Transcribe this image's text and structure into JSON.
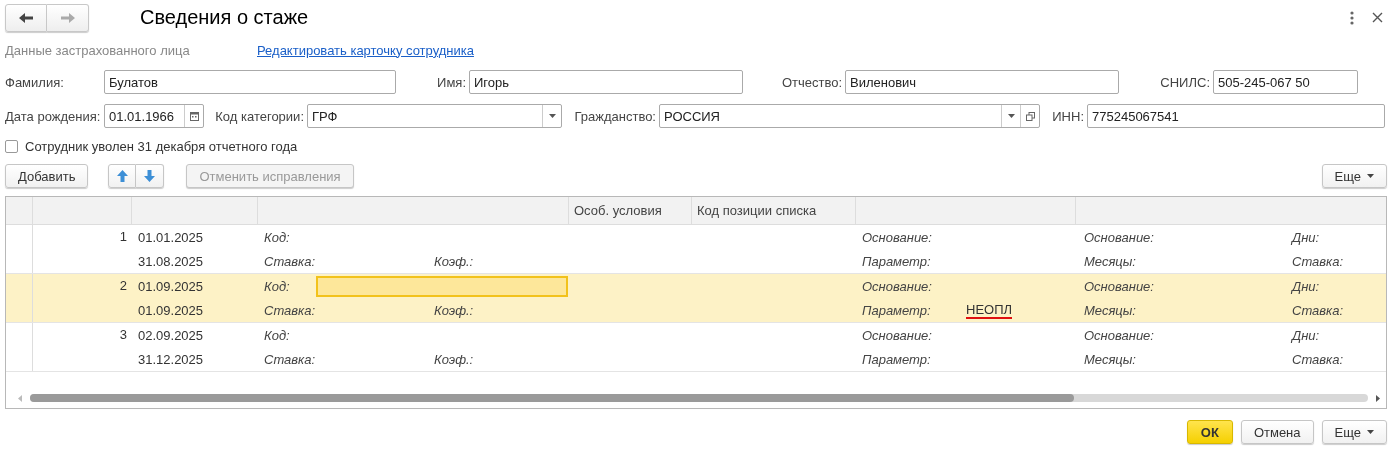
{
  "window": {
    "title": "Сведения о стаже"
  },
  "insured": {
    "section_label": "Данные застрахованного лица",
    "edit_link": "Редактировать карточку сотрудника"
  },
  "field_rows": [
    [
      {
        "kind": "text",
        "label": "Фамилия:",
        "value": "Булатов"
      },
      {
        "kind": "text",
        "label": "Имя:",
        "value": "Игорь"
      },
      {
        "kind": "text",
        "label": "Отчество:",
        "value": "Виленович"
      },
      {
        "kind": "text",
        "label": "СНИЛС:",
        "value": "505-245-067 50"
      }
    ],
    [
      {
        "kind": "date",
        "label": "Дата рождения:",
        "value": "01.01.1966"
      },
      {
        "kind": "combo",
        "label": "Код категории:",
        "value": "ГРФ"
      },
      {
        "kind": "combo_open",
        "label": "Гражданство:",
        "value": "РОССИЯ"
      },
      {
        "kind": "text",
        "label": "ИНН:",
        "value": "775245067541"
      }
    ]
  ],
  "dismissed": {
    "label": "Сотрудник уволен 31 декабря отчетного года",
    "checked": false
  },
  "toolbar": {
    "add": "Добавить",
    "undo_fix": {
      "label": "Отменить исправления",
      "disabled": true
    },
    "more": "Еще"
  },
  "table": {
    "columns": [
      "Особ. условия",
      "Код позиции списка"
    ],
    "rows": [
      {
        "number": "1",
        "date_from": "01.01.2025",
        "date_to": "31.08.2025",
        "selected": false,
        "editing": false,
        "code_label": "Код:",
        "rate_label": "Ставка:",
        "coef_label": "Коэф.:",
        "basis_label": "Основание:",
        "param_label": "Параметр:",
        "basis2_label": "Основание:",
        "months_label": "Месяцы:",
        "days_label": "Дни:",
        "rate2_label": "Ставка:"
      },
      {
        "number": "2",
        "date_from": "01.09.2025",
        "date_to": "01.09.2025",
        "selected": true,
        "editing": true,
        "code_label": "Код:",
        "rate_label": "Ставка:",
        "coef_label": "Коэф.:",
        "basis_label": "Основание:",
        "param_label": "Параметр:",
        "param": {
          "value": "НЕОПЛ",
          "flagged": true
        },
        "basis2_label": "Основание:",
        "months_label": "Месяцы:",
        "days_label": "Дни:",
        "rate2_label": "Ставка:"
      },
      {
        "number": "3",
        "date_from": "02.09.2025",
        "date_to": "31.12.2025",
        "selected": false,
        "editing": false,
        "code_label": "Код:",
        "rate_label": "Ставка:",
        "coef_label": "Коэф.:",
        "basis_label": "Основание:",
        "param_label": "Параметр:",
        "basis2_label": "Основание:",
        "months_label": "Месяцы:",
        "days_label": "Дни:",
        "rate2_label": "Ставка:"
      }
    ]
  },
  "footer": {
    "ok": "ОК",
    "cancel": "Отмена",
    "more": "Еще"
  }
}
